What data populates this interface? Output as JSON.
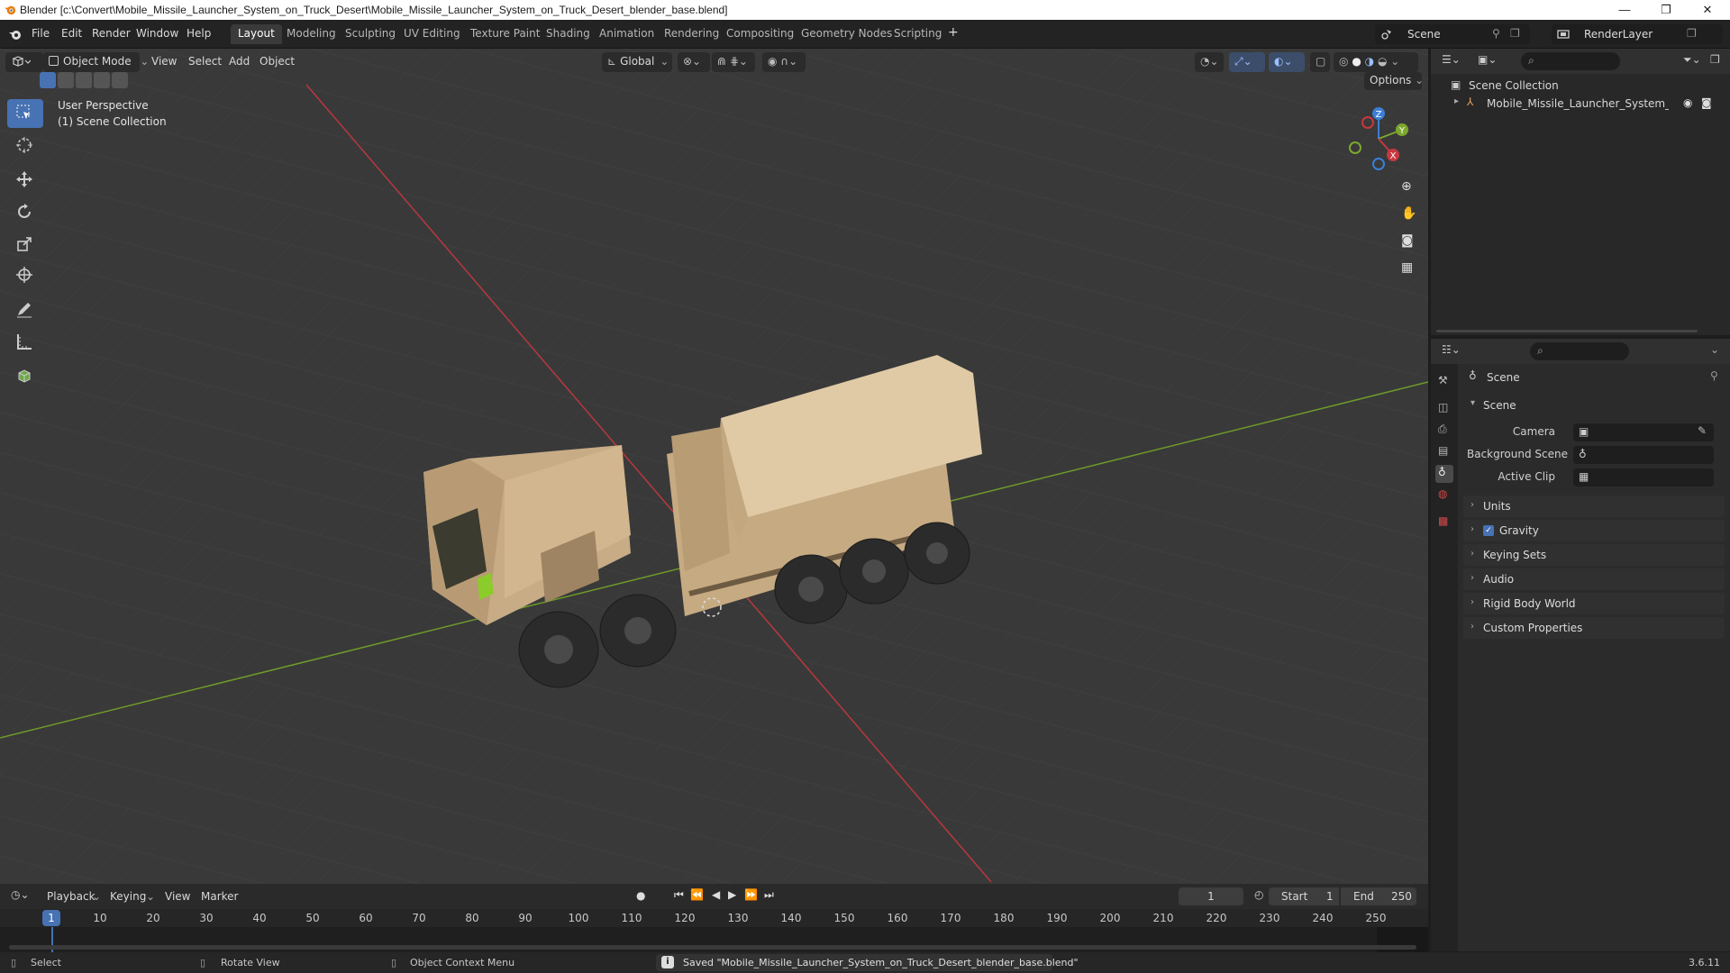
{
  "window": {
    "title": "Blender [c:\\Convert\\Mobile_Missile_Launcher_System_on_Truck_Desert\\Mobile_Missile_Launcher_System_on_Truck_Desert_blender_base.blend]",
    "minimize": "—",
    "maximize": "❐",
    "close": "✕"
  },
  "menu": {
    "items": [
      "File",
      "Edit",
      "Render",
      "Window",
      "Help"
    ],
    "workspaces": [
      "Layout",
      "Modeling",
      "Sculpting",
      "UV Editing",
      "Texture Paint",
      "Shading",
      "Animation",
      "Rendering",
      "Compositing",
      "Geometry Nodes",
      "Scripting"
    ],
    "active_workspace": "Layout",
    "add_tab": "+",
    "scene_name": "Scene",
    "view_layer": "RenderLayer"
  },
  "viewport": {
    "mode": "Object Mode",
    "menus": [
      "View",
      "Select",
      "Add",
      "Object"
    ],
    "transform_orientation": "Global",
    "options": "Options",
    "perspective_label": "User Perspective",
    "collection_label": "(1) Scene Collection",
    "gizmo_axes": {
      "x": "X",
      "y": "Y",
      "z": "Z"
    },
    "colors": {
      "x_axis": "#c8383f",
      "y_axis": "#7ca72e",
      "z_axis": "#3b7fd6",
      "active_tool": "#4772b3"
    }
  },
  "outliner": {
    "root": "Scene Collection",
    "object": "Mobile_Missile_Launcher_System_on_Tr"
  },
  "properties": {
    "context": "Scene",
    "section": "Scene",
    "fields": [
      {
        "label": "Camera",
        "value": ""
      },
      {
        "label": "Background Scene",
        "value": ""
      },
      {
        "label": "Active Clip",
        "value": ""
      }
    ],
    "panels": [
      {
        "label": "Units",
        "checkbox": false
      },
      {
        "label": "Gravity",
        "checkbox": true
      },
      {
        "label": "Keying Sets",
        "checkbox": false
      },
      {
        "label": "Audio",
        "checkbox": false
      },
      {
        "label": "Rigid Body World",
        "checkbox": false
      },
      {
        "label": "Custom Properties",
        "checkbox": false
      }
    ]
  },
  "timeline": {
    "menus": [
      "Playback",
      "Keying",
      "View",
      "Marker"
    ],
    "current_frame": "1",
    "start_label": "Start",
    "start": "1",
    "end_label": "End",
    "end": "250",
    "ticks": [
      "10",
      "20",
      "30",
      "40",
      "50",
      "60",
      "70",
      "80",
      "90",
      "100",
      "110",
      "120",
      "130",
      "140",
      "150",
      "160",
      "170",
      "180",
      "190",
      "200",
      "210",
      "220",
      "230",
      "240",
      "250"
    ],
    "playhead_label": "1"
  },
  "status": {
    "select": "Select",
    "rotate": "Rotate View",
    "context_menu": "Object Context Menu",
    "message": "Saved \"Mobile_Missile_Launcher_System_on_Truck_Desert_blender_base.blend\"",
    "version": "3.6.11"
  }
}
